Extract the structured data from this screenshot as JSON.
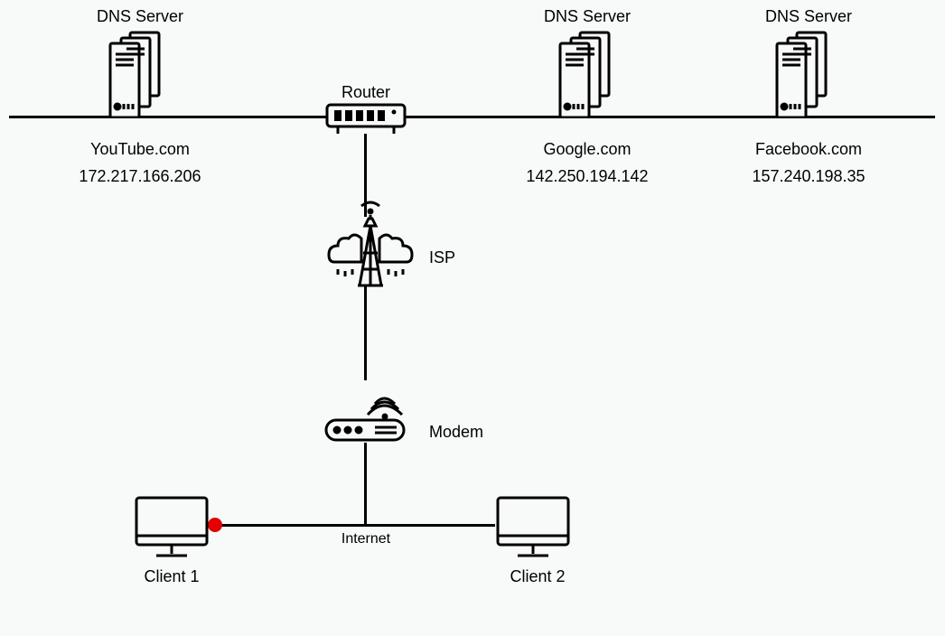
{
  "servers": [
    {
      "title": "DNS Server",
      "domain": "YouTube.com",
      "ip": "172.217.166.206"
    },
    {
      "title": "DNS Server",
      "domain": "Google.com",
      "ip": "142.250.194.142"
    },
    {
      "title": "DNS Server",
      "domain": "Facebook.com",
      "ip": "157.240.198.35"
    }
  ],
  "router_label": "Router",
  "isp_label": "ISP",
  "modem_label": "Modem",
  "internet_label": "Internet",
  "clients": [
    {
      "label": "Client 1"
    },
    {
      "label": "Client 2"
    }
  ],
  "dot_color": "#e40000"
}
